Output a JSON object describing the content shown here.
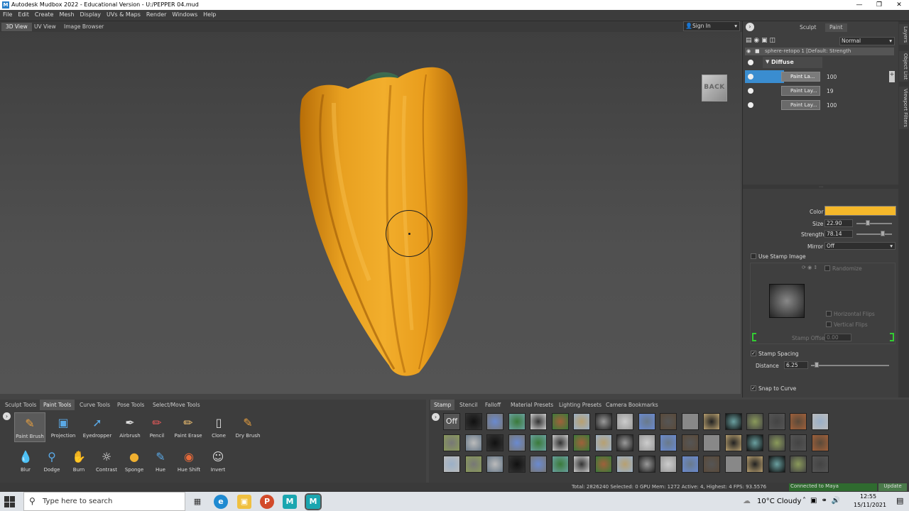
{
  "window": {
    "title": "Autodesk Mudbox 2022 - Educational Version - U:/PEPPER 04.mud",
    "app_icon_letter": "M"
  },
  "menu": [
    "File",
    "Edit",
    "Create",
    "Mesh",
    "Display",
    "UVs & Maps",
    "Render",
    "Windows",
    "Help"
  ],
  "view_tabs": [
    "3D View",
    "UV View",
    "Image Browser"
  ],
  "signin": "Sign In",
  "viewport": {
    "cube_label": "BACK"
  },
  "right_panel": {
    "modes": [
      "Sculpt",
      "Paint"
    ],
    "blend_mode": "Normal",
    "mesh_row": "sphere-retopo 1 [Default: Strength",
    "channel": "Diffuse",
    "layers": [
      {
        "name": "Paint La...",
        "value": "100"
      },
      {
        "name": "Paint Lay...",
        "value": "19"
      },
      {
        "name": "Paint Lay...",
        "value": "100"
      }
    ],
    "properties": {
      "color_label": "Color",
      "color_value": "#f5b82a",
      "size_label": "Size",
      "size_value": "22.90",
      "size_fraction": 0.3,
      "strength_label": "Strength",
      "strength_value": "78.14",
      "strength_fraction": 0.78,
      "mirror_label": "Mirror",
      "mirror_value": "Off",
      "use_stamp": "Use Stamp Image",
      "randomize": "Randomize",
      "horizontal_flips": "Horizontal Flips",
      "vertical_flips": "Vertical Flips",
      "stamp_offset_label": "Stamp Offset",
      "stamp_offset_value": "0.00",
      "stamp_spacing": "Stamp Spacing",
      "distance_label": "Distance",
      "distance_value": "6.25",
      "snap_to_curve": "Snap to Curve"
    }
  },
  "side_tabs": [
    "Layers",
    "Object List",
    "Viewport Filters"
  ],
  "tool_tabs": [
    "Sculpt Tools",
    "Paint Tools",
    "Curve Tools",
    "Pose Tools",
    "Select/Move Tools"
  ],
  "tools_row1": [
    {
      "label": "Paint Brush",
      "icon": "paint-brush-icon"
    },
    {
      "label": "Projection",
      "icon": "projection-icon"
    },
    {
      "label": "Eyedropper",
      "icon": "eyedropper-icon"
    },
    {
      "label": "Airbrush",
      "icon": "airbrush-icon"
    },
    {
      "label": "Pencil",
      "icon": "pencil-icon"
    },
    {
      "label": "Paint Erase",
      "icon": "paint-erase-icon"
    },
    {
      "label": "Clone",
      "icon": "clone-icon"
    },
    {
      "label": "Dry Brush",
      "icon": "dry-brush-icon"
    }
  ],
  "tools_row2": [
    {
      "label": "Blur",
      "icon": "blur-icon"
    },
    {
      "label": "Dodge",
      "icon": "dodge-icon"
    },
    {
      "label": "Burn",
      "icon": "burn-icon"
    },
    {
      "label": "Contrast",
      "icon": "contrast-icon"
    },
    {
      "label": "Sponge",
      "icon": "sponge-icon"
    },
    {
      "label": "Hue",
      "icon": "hue-icon"
    },
    {
      "label": "Hue Shift",
      "icon": "hue-shift-icon"
    },
    {
      "label": "Invert",
      "icon": "invert-icon"
    }
  ],
  "tray_tabs": [
    "Stamp",
    "Stencil",
    "Falloff",
    "Material Presets",
    "Lighting Presets",
    "Camera Bookmarks"
  ],
  "stamp_off": "Off",
  "status": {
    "text": "Total: 2826240  Selected: 0 GPU Mem: 1272  Active: 4, Highest: 4  FPS: 93.5576",
    "connected": "Connected to Maya",
    "update": "Update"
  },
  "taskbar": {
    "search_placeholder": "Type here to search",
    "weather": "10°C  Cloudy",
    "time": "12:55",
    "date": "15/11/2021"
  }
}
